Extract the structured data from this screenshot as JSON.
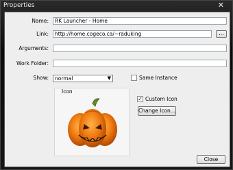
{
  "window": {
    "title": "Properties",
    "close_glyph": "✕"
  },
  "form": {
    "name_label": "Name:",
    "name_value": "RK Launcher - Home",
    "link_label": "Link:",
    "link_value": "http://home.cogeco.ca/~raduking",
    "browse_label": "...",
    "arguments_label": "Arguments:",
    "arguments_value": "",
    "workfolder_label": "Work Folder:",
    "workfolder_value": "",
    "show_label": "Show:",
    "show_value": "normal",
    "same_instance_label": "Same Instance",
    "same_instance_checked": false,
    "icon_group_label": "Icon",
    "custom_icon_label": "Custom Icon",
    "custom_icon_checked": true,
    "check_mark": "✓",
    "change_icon_label": "Change Icon...",
    "close_label": "Close"
  },
  "icons": {
    "preview": "pumpkin-icon",
    "dropdown_arrow": "▼"
  },
  "colors": {
    "pumpkin_orange": "#f07a10",
    "stem_green": "#6a8a2a"
  }
}
